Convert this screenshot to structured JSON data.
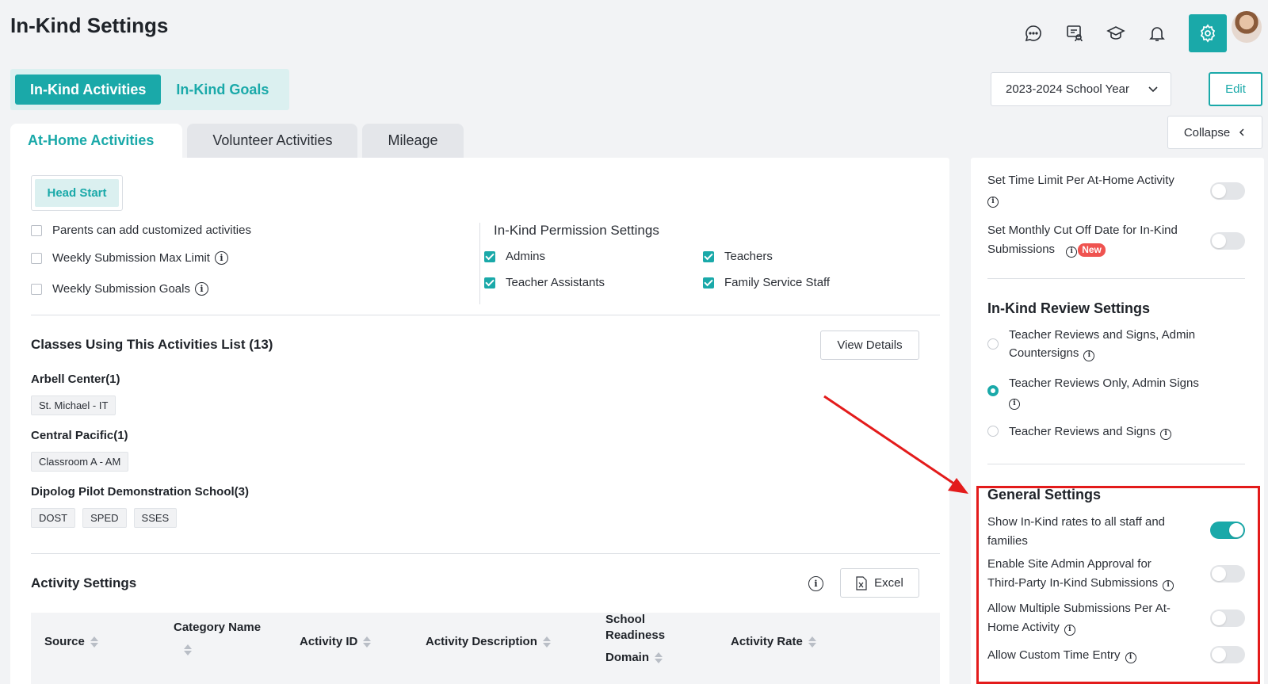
{
  "header": {
    "title": "In-Kind Settings",
    "icons": [
      "chat-icon",
      "feedback-icon",
      "graduation-cap-icon",
      "bell-icon",
      "gear-icon"
    ]
  },
  "main_tabs": [
    {
      "label": "In-Kind Activities",
      "active": true
    },
    {
      "label": "In-Kind Goals",
      "active": false
    }
  ],
  "year_select": {
    "value": "2023-2024 School Year"
  },
  "edit_label": "Edit",
  "collapse_label": "Collapse",
  "sub_tabs": [
    {
      "label": "At-Home Activities",
      "active": true
    },
    {
      "label": "Volunteer Activities",
      "active": false
    },
    {
      "label": "Mileage",
      "active": false
    }
  ],
  "program_chip": "Head Start",
  "options": [
    {
      "label": "Parents can add customized activities",
      "checked": false,
      "info": false
    },
    {
      "label": "Weekly Submission Max Limit",
      "checked": false,
      "info": true
    },
    {
      "label": "Weekly Submission Goals",
      "checked": false,
      "info": true
    }
  ],
  "permissions": {
    "title": "In-Kind Permission Settings",
    "items": [
      {
        "label": "Admins",
        "checked": true
      },
      {
        "label": "Teachers",
        "checked": true
      },
      {
        "label": "Teacher Assistants",
        "checked": true
      },
      {
        "label": "Family Service Staff",
        "checked": true
      }
    ]
  },
  "classes": {
    "title": "Classes Using This Activities List (13)",
    "view_details": "View Details",
    "sites": [
      {
        "name": "Arbell Center(1)",
        "classes": [
          "St. Michael - IT"
        ]
      },
      {
        "name": "Central Pacific(1)",
        "classes": [
          "Classroom A - AM"
        ]
      },
      {
        "name": "Dipolog Pilot Demonstration School(3)",
        "classes": [
          "DOST",
          "SPED",
          "SSES"
        ]
      }
    ]
  },
  "activity_settings": {
    "title": "Activity Settings",
    "excel_label": "Excel",
    "columns": {
      "source": "Source",
      "category_1": "Category Name",
      "activity_id": "Activity ID",
      "description": "Activity Description",
      "readiness_1": "School",
      "readiness_2": "Readiness",
      "readiness_3": "Domain",
      "rate": "Activity Rate"
    }
  },
  "right_panel": {
    "toggle_time_limit": {
      "label": "Set Time Limit Per At-Home Activity",
      "on": false
    },
    "toggle_cutoff": {
      "label": "Set Monthly Cut Off Date for In-Kind",
      "label2": "Submissions",
      "badge": "New",
      "on": false
    },
    "review": {
      "title": "In-Kind Review Settings",
      "options": [
        {
          "line1": "Teacher Reviews and Signs, Admin",
          "line2": "Countersigns",
          "selected": false
        },
        {
          "line1": "Teacher Reviews Only, Admin Signs",
          "line2": "",
          "selected": true
        },
        {
          "line1": "Teacher Reviews and Signs",
          "line2": "",
          "selected": false
        }
      ]
    },
    "general": {
      "title": "General Settings",
      "items": [
        {
          "line1": "Show In-Kind rates to all staff and",
          "line2": "families",
          "on": true
        },
        {
          "line1": "Enable Site Admin Approval for",
          "line2": "Third-Party In-Kind Submissions",
          "on": false
        },
        {
          "line1": "Allow Multiple Submissions Per At-",
          "line2": "Home Activity",
          "on": false
        },
        {
          "line1": "Allow Custom Time Entry",
          "line2": "",
          "on": false
        }
      ]
    }
  },
  "colors": {
    "accent": "#1aa9a9",
    "accent_light": "#dbf0f0",
    "annotation_red": "#e31b1b",
    "badge_red": "#ef5350"
  }
}
